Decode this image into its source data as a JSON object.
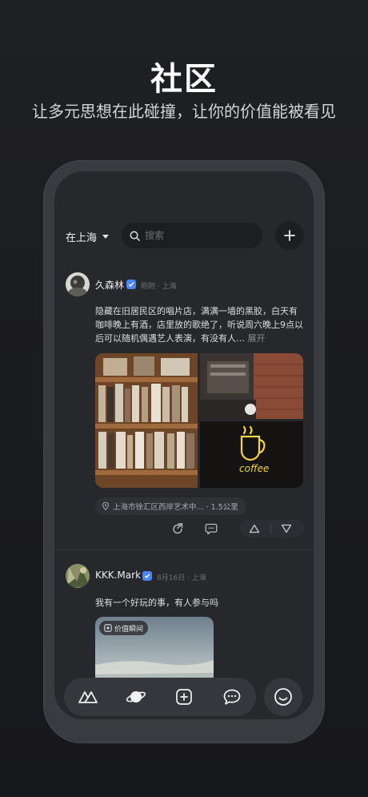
{
  "hero": {
    "title": "社区",
    "subtitle": "让多元思想在此碰撞，让你的价值能被看见"
  },
  "header": {
    "location": "在上海",
    "search_placeholder": "搜索"
  },
  "posts": [
    {
      "username": "久森林",
      "meta": "刚刚 · 上海",
      "text": "隐藏在旧居民区的唱片店，满满一墙的黑胶，白天有咖啡晚上有酒，店里放的歌绝了，听说周六晚上9点以后可以随机偶遇艺人表演，有没有人…",
      "expand_label": "展开",
      "location_chip": "上海市徐汇区西岸艺术中... · 1.5公里"
    },
    {
      "username": "KKK.Mark",
      "meta": "8月16日 · 上海",
      "text": "我有一个好玩的事，有人参与吗",
      "badge": "价值瞬间"
    }
  ],
  "icons": {
    "search": "search-icon",
    "add": "plus-icon",
    "share": "share-icon",
    "comment": "comment-icon",
    "upvote": "triangle-up-icon",
    "downvote": "triangle-down-icon",
    "verified": "verified-check-icon"
  },
  "colors": {
    "background": "#1c1d21",
    "phone_bezel": "#3a3b40",
    "screen": "#27282c",
    "verified_blue": "#4a86f5",
    "neon_yellow": "#f3d34a"
  }
}
